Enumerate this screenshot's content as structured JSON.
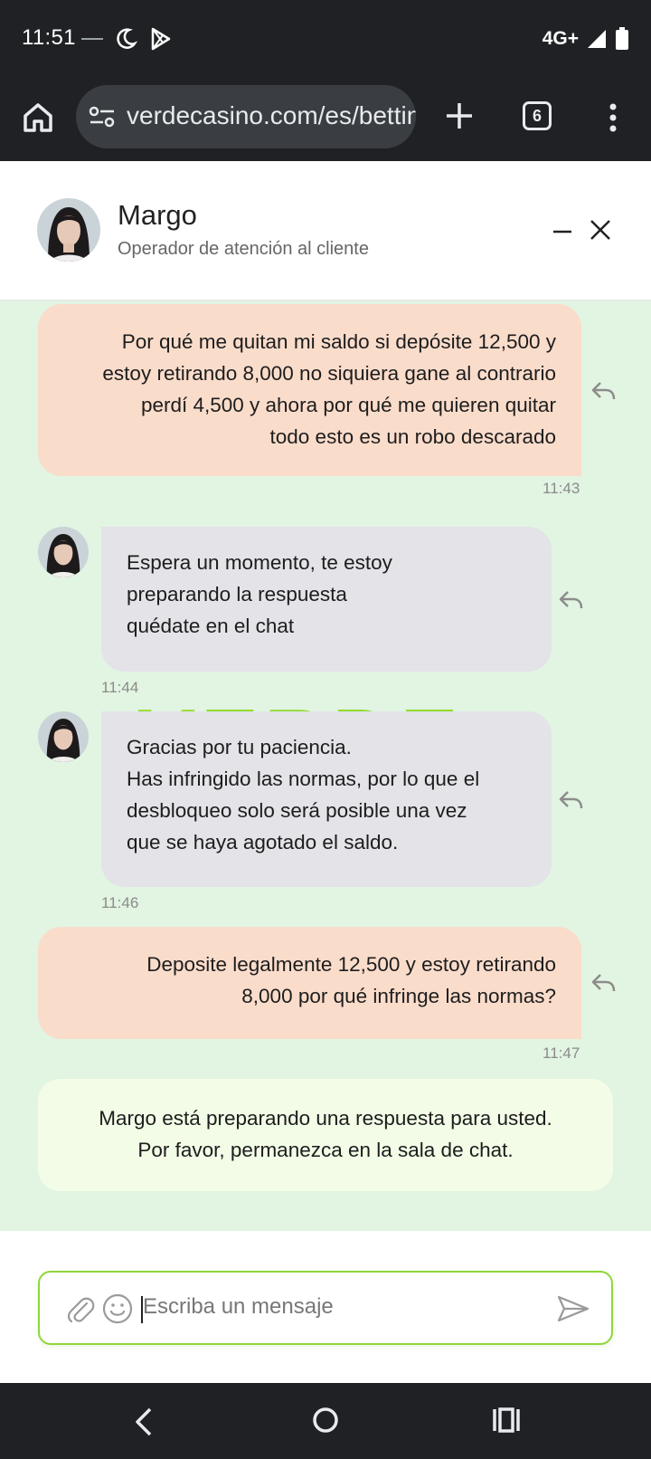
{
  "status_bar": {
    "time": "11:51",
    "network": "4G+",
    "icons": [
      "notification-dots-icon",
      "moon-icon",
      "play-store-icon",
      "signal-icon",
      "battery-icon"
    ]
  },
  "browser": {
    "url": "verdecasino.com/es/betting",
    "tab_count": "6",
    "icons": [
      "home-icon",
      "site-settings-icon",
      "new-tab-icon",
      "tab-switcher-icon",
      "menu-icon"
    ]
  },
  "chat_header": {
    "agent_name": "Margo",
    "agent_role": "Operador de atención al cliente"
  },
  "messages": [
    {
      "side": "user",
      "lines": [
        "Por qué me quitan mi saldo si depósite 12,500 y",
        "estoy retirando 8,000 no siquiera gane al contrario",
        "perdí 4,500 y ahora por qué me quieren quitar",
        "todo esto es un robo descarado"
      ],
      "time": "11:43"
    },
    {
      "side": "agent",
      "lines": [
        "Espera un momento, te estoy",
        "preparando la respuesta",
        "quédate en el chat"
      ],
      "time": "11:44"
    },
    {
      "side": "agent",
      "lines": [
        "Gracias por tu paciencia.",
        "Has infringido las normas, por lo que el",
        "desbloqueo solo será posible una vez",
        "que se haya agotado el saldo."
      ],
      "time": "11:46"
    },
    {
      "side": "user",
      "lines": [
        "Deposite legalmente 12,500 y estoy retirando",
        "8,000 por qué infringe las normas?"
      ],
      "time": "11:47"
    }
  ],
  "typing_notice": {
    "lines": [
      "Margo está preparando una respuesta para usted.",
      "Por favor, permanezca en la sala de chat."
    ]
  },
  "watermark": "VERDE",
  "composer": {
    "placeholder": "Escriba un mensaje"
  },
  "colors": {
    "chat_bg": "#e2f4e2",
    "user_bubble": "#fadccb",
    "agent_bubble": "#e3e3e8",
    "notice_bg": "#f2fce6",
    "accent_green": "#8fd63a",
    "system_bar": "#1f2124"
  }
}
